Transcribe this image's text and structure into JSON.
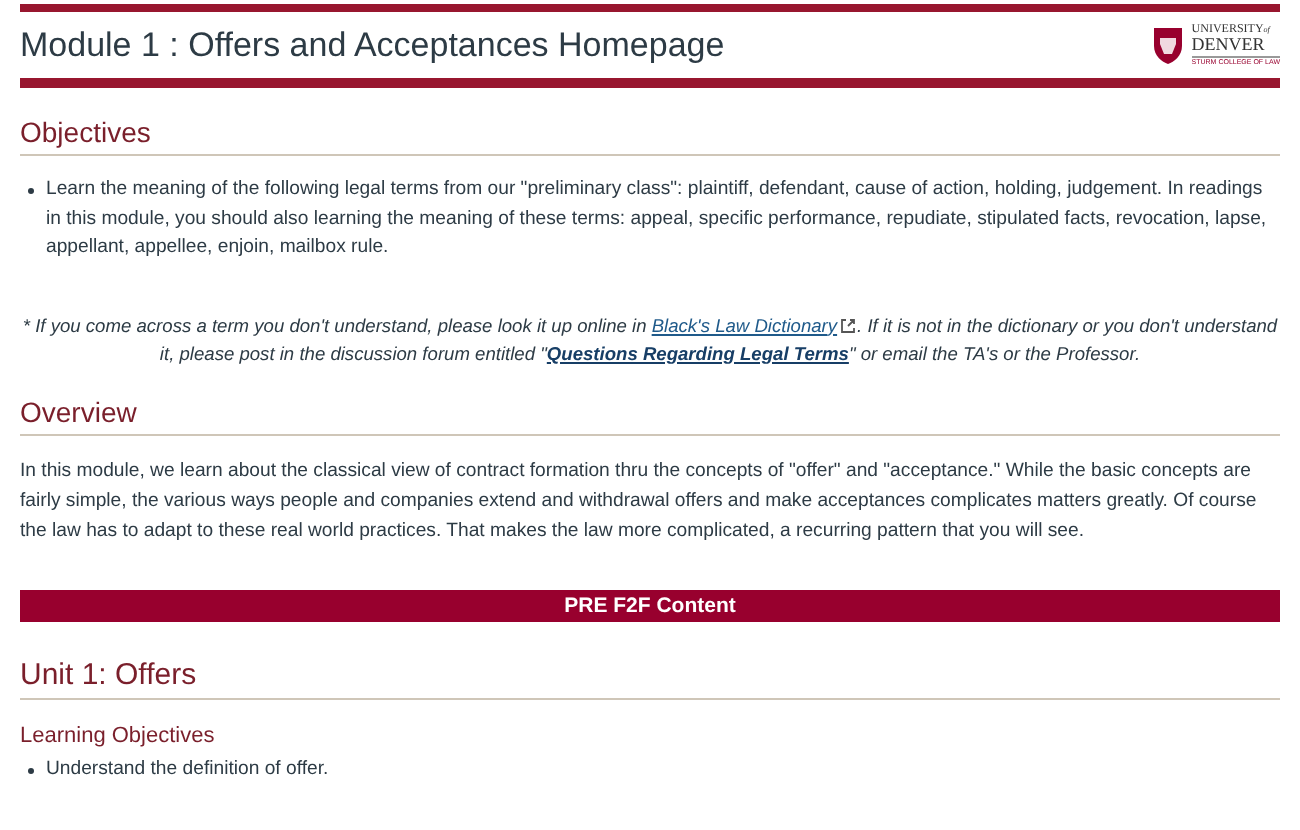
{
  "header": {
    "title": "Module 1 : Offers and Acceptances Homepage",
    "logo": {
      "line_1": "UNIVERSITY",
      "line_1_small": "of",
      "line_2": "DENVER",
      "line_3": "STURM COLLEGE OF LAW"
    }
  },
  "objectives": {
    "heading": "Objectives",
    "bullets": [
      "Learn the meaning of the following legal terms from our \"preliminary class\":  plaintiff, defendant, cause of action, holding, judgement.  In readings in this module, you should also learning the meaning of these terms: appeal, specific performance, repudiate, stipulated facts, revocation, lapse, appellant, appellee, enjoin, mailbox rule."
    ],
    "note": {
      "before": "* If you come across a term you don't understand, please look it up online in ",
      "link_1": "Black's Law Dictionary",
      "middle": ".   If it is not in the dictionary or you don't understand it, please post in the discussion forum entitled \"",
      "link_2": "Questions Regarding Legal Terms",
      "after": "\" or email the TA's or the Professor."
    }
  },
  "overview": {
    "heading": "Overview",
    "text": "In this module, we learn about the classical view of contract formation thru the concepts of \"offer\" and \"acceptance.\"  While the basic concepts are fairly simple, the various ways people and companies extend and withdrawal offers and make acceptances complicates matters greatly.  Of course the law has to adapt to these real world practices.  That makes the law more complicated, a recurring pattern that you will see."
  },
  "banner": "PRE F2F Content",
  "unit": {
    "heading": "Unit 1: Offers",
    "subheading": "Learning Objectives",
    "bullets": [
      "Understand the definition of offer."
    ]
  }
}
